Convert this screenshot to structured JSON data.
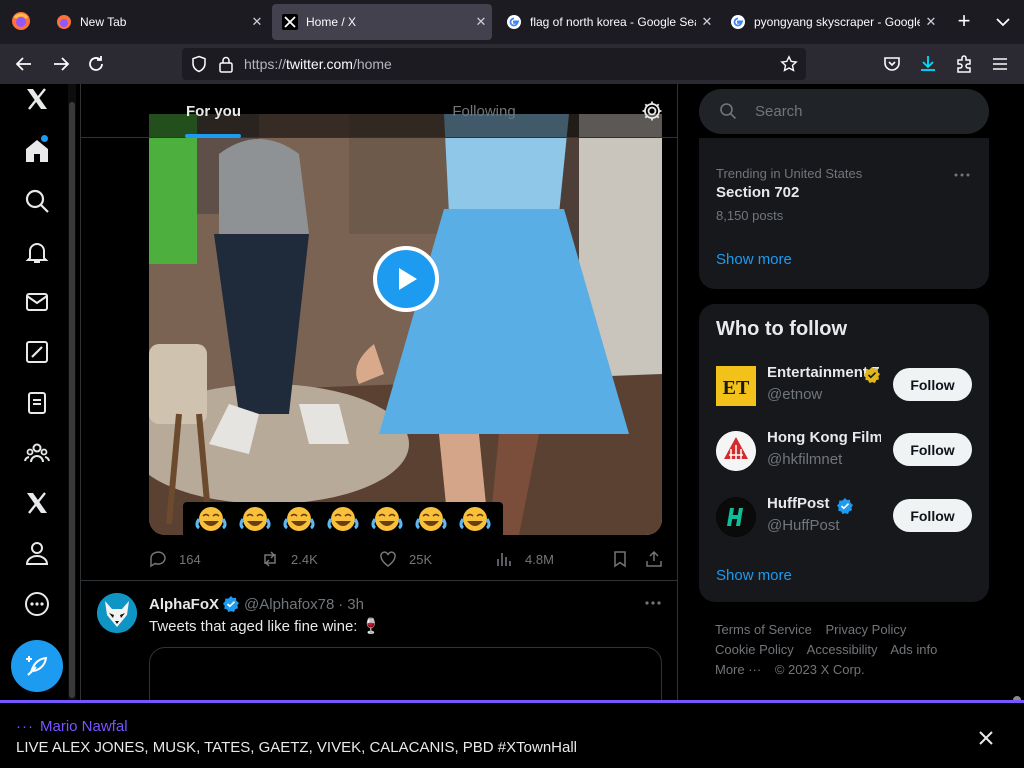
{
  "browser": {
    "tabs": [
      {
        "label": "New Tab",
        "icon": "firefox-icon",
        "active": false
      },
      {
        "label": "Home / X",
        "icon": "x-logo-icon",
        "active": true
      },
      {
        "label": "flag of north korea - Google Search",
        "icon": "google-icon",
        "active": false
      },
      {
        "label": "pyongyang skyscraper - Google Search",
        "icon": "google-icon",
        "active": false
      }
    ],
    "url_scheme": "https://",
    "url_host": "twitter.com",
    "url_path": "/home"
  },
  "nav": {
    "items": [
      "home",
      "explore",
      "notifications",
      "messages",
      "grok",
      "lists",
      "communities",
      "premium",
      "profile",
      "more"
    ],
    "has_notification_dot": true
  },
  "feed": {
    "tabs": [
      "For you",
      "Following"
    ],
    "active_tab": "For you",
    "tweet1": {
      "media": "video",
      "emoji_overlay": [
        "😂",
        "😂",
        "😂",
        "😂",
        "😂",
        "😂",
        "😂"
      ],
      "replies": "164",
      "retweets": "2.4K",
      "likes": "25K",
      "views": "4.8M"
    },
    "tweet2": {
      "name": "AlphaFoX",
      "handle": "@Alphafox78",
      "time": "3h",
      "text": "Tweets that aged like fine wine: 🍷",
      "verified": true
    }
  },
  "sidebar": {
    "search_placeholder": "Search",
    "trend": {
      "meta": "Trending in United States",
      "title": "Section 702",
      "count": "8,150 posts"
    },
    "show_more": "Show more",
    "who_to_follow": {
      "title": "Who to follow",
      "accounts": [
        {
          "name": "Entertainment Tonight",
          "handle": "@etnow",
          "badge": "gold",
          "button": "Follow"
        },
        {
          "name": "Hong Kong Film",
          "handle": "@hkfilmnet",
          "badge": "none",
          "button": "Follow"
        },
        {
          "name": "HuffPost",
          "handle": "@HuffPost",
          "badge": "blue",
          "button": "Follow"
        }
      ]
    },
    "footer": {
      "row1": [
        "Terms of Service",
        "Privacy Policy"
      ],
      "row2": [
        "Cookie Policy",
        "Accessibility",
        "Ads info"
      ],
      "more": "More ···",
      "copyright": "© 2023 X Corp."
    }
  },
  "space": {
    "host": "Mario Nawfal",
    "title": "LIVE ALEX JONES, MUSK, TATES, GAETZ, VIVEK, CALACANIS, PBD #XTownHall"
  },
  "colors": {
    "accent": "#1d9bf0",
    "space": "#7856ff",
    "gold_badge": "#e2b719"
  }
}
